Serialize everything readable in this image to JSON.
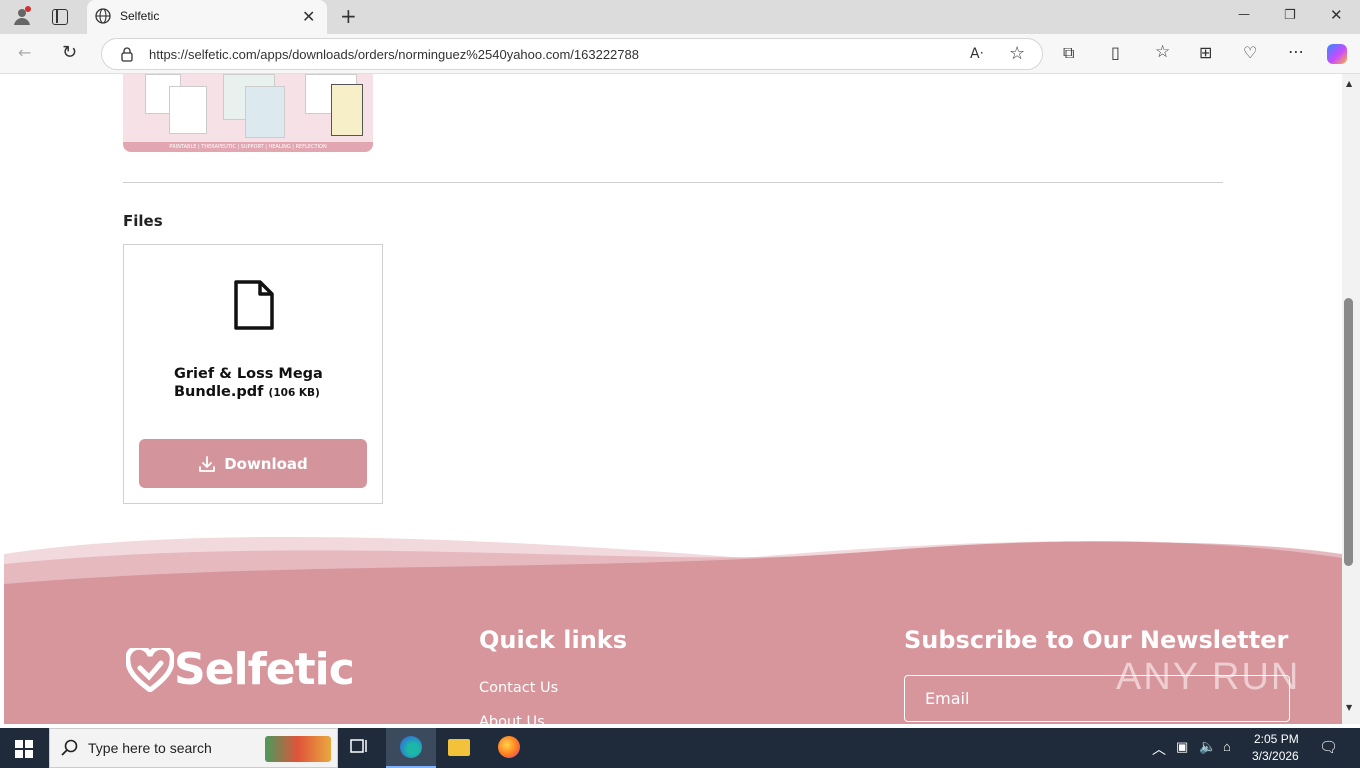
{
  "browser": {
    "tab_title": "Selfetic",
    "url": "https://selfetic.com/apps/downloads/orders/norminguez%2540yahoo.com/163222788",
    "tab_close": "✕",
    "new_tab": "+",
    "minimize": "—",
    "restore": "❐",
    "close": "✕",
    "read_aloud": "Aᐧ"
  },
  "page": {
    "files_heading": "Files",
    "file": {
      "name": "Grief & Loss Mega Bundle.pdf",
      "size": "(106 KB)",
      "download_label": "Download"
    },
    "product_image_caption": "PRINTABLE | THERAPEUTIC | SUPPORT | HEALING | REFLECTION"
  },
  "footer": {
    "logo_text": "Selfetic",
    "quick_links_heading": "Quick links",
    "quick_links": [
      "Contact Us",
      "About Us"
    ],
    "newsletter_heading": "Subscribe to Our Newsletter",
    "email_placeholder": "Email",
    "watermark": "ANY RUN"
  },
  "taskbar": {
    "search_placeholder": "Type here to search",
    "time": "2:05 PM",
    "date": "3/3/2026"
  },
  "colors": {
    "accent": "#d4949c",
    "footer_bg": "#d7959c"
  }
}
